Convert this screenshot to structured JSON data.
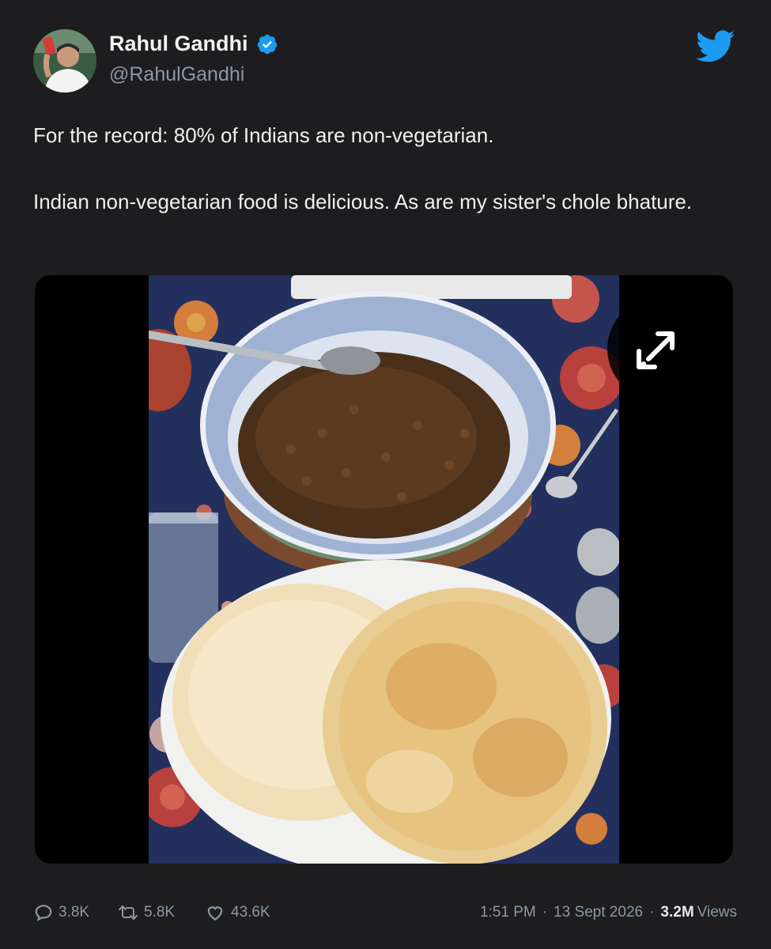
{
  "tweet": {
    "author": {
      "name": "Rahul Gandhi",
      "handle": "@RahulGandhi",
      "verified": true,
      "avatar_icon": "avatar-portrait"
    },
    "brand_icon": "twitter-bird-icon",
    "text_paragraphs": [
      "For the record: 80% of Indians are non-vegetarian.",
      "Indian non-vegetarian food is delicious. As are my sister's chole bhature."
    ],
    "media": {
      "kind": "photo",
      "expand_icon": "expand-arrows-icon"
    },
    "stats": {
      "replies": "3.8K",
      "retweets": "5.8K",
      "likes": "43.6K"
    },
    "meta": {
      "time": "1:51 PM",
      "separator": "·",
      "date": "13 Sept 2026",
      "views": "3.2M",
      "views_label": "Views"
    }
  },
  "colors": {
    "background": "#1d1d1f",
    "accent": "#1d9bf0",
    "muted_text": "#8b98a5"
  }
}
